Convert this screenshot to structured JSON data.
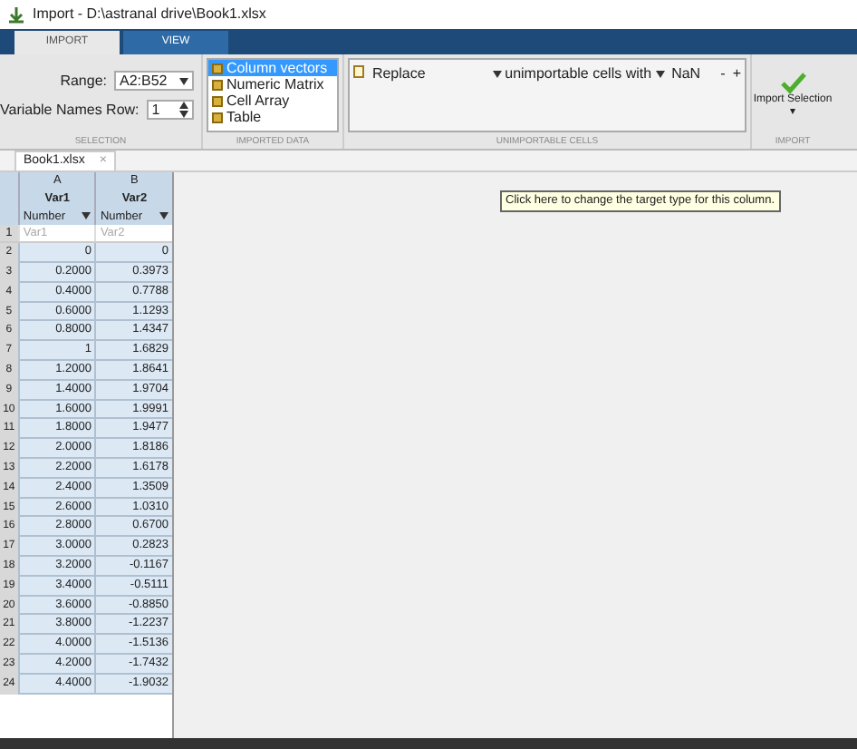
{
  "window": {
    "title": "Import - D:\\astranal drive\\Book1.xlsx"
  },
  "tabs": [
    {
      "label": "IMPORT",
      "selected": true
    },
    {
      "label": "VIEW",
      "selected": false
    }
  ],
  "selection": {
    "range_label": "Range:",
    "range_value": "A2:B52",
    "var_names_label": "Variable Names Row:",
    "var_names_value": "1",
    "section": "SELECTION"
  },
  "imported_data": {
    "options": [
      {
        "label": "Column vectors",
        "selected": true
      },
      {
        "label": "Numeric Matrix",
        "selected": false
      },
      {
        "label": "Cell Array",
        "selected": false
      },
      {
        "label": "Table",
        "selected": false
      }
    ],
    "section": "IMPORTED DATA"
  },
  "unimportable": {
    "rule_action": "Replace",
    "rule_checked": false,
    "rule_target": "unimportable cells with",
    "rule_value": "NaN",
    "minus": "-",
    "plus": "+",
    "section": "UNIMPORTABLE CELLS"
  },
  "import_button": {
    "label": "Import Selection",
    "caret": "▾",
    "section": "IMPORT"
  },
  "document_tab": {
    "label": "Book1.xlsx",
    "close": "×"
  },
  "table": {
    "columns": [
      {
        "letter": "A",
        "name": "Var1",
        "type": "Number",
        "header_hint": "Var1"
      },
      {
        "letter": "B",
        "name": "Var2",
        "type": "Number",
        "header_hint": "Var2"
      }
    ],
    "header_row": "1",
    "rows": [
      {
        "n": "2",
        "a": "0",
        "b": "0"
      },
      {
        "n": "3",
        "a": "0.2000",
        "b": "0.3973"
      },
      {
        "n": "4",
        "a": "0.4000",
        "b": "0.7788"
      },
      {
        "n": "5",
        "a": "0.6000",
        "b": "1.1293"
      },
      {
        "n": "6",
        "a": "0.8000",
        "b": "1.4347"
      },
      {
        "n": "7",
        "a": "1",
        "b": "1.6829"
      },
      {
        "n": "8",
        "a": "1.2000",
        "b": "1.8641"
      },
      {
        "n": "9",
        "a": "1.4000",
        "b": "1.9704"
      },
      {
        "n": "10",
        "a": "1.6000",
        "b": "1.9991"
      },
      {
        "n": "11",
        "a": "1.8000",
        "b": "1.9477"
      },
      {
        "n": "12",
        "a": "2.0000",
        "b": "1.8186"
      },
      {
        "n": "13",
        "a": "2.2000",
        "b": "1.6178"
      },
      {
        "n": "14",
        "a": "2.4000",
        "b": "1.3509"
      },
      {
        "n": "15",
        "a": "2.6000",
        "b": "1.0310"
      },
      {
        "n": "16",
        "a": "2.8000",
        "b": "0.6700"
      },
      {
        "n": "17",
        "a": "3.0000",
        "b": "0.2823"
      },
      {
        "n": "18",
        "a": "3.2000",
        "b": "-0.1167"
      },
      {
        "n": "19",
        "a": "3.4000",
        "b": "-0.5111"
      },
      {
        "n": "20",
        "a": "3.6000",
        "b": "-0.8850"
      },
      {
        "n": "21",
        "a": "3.8000",
        "b": "-1.2237"
      },
      {
        "n": "22",
        "a": "4.0000",
        "b": "-1.5136"
      },
      {
        "n": "23",
        "a": "4.2000",
        "b": "-1.7432"
      },
      {
        "n": "24",
        "a": "4.4000",
        "b": "-1.9032"
      }
    ]
  },
  "tooltip": "Click here to change the target type for this column."
}
